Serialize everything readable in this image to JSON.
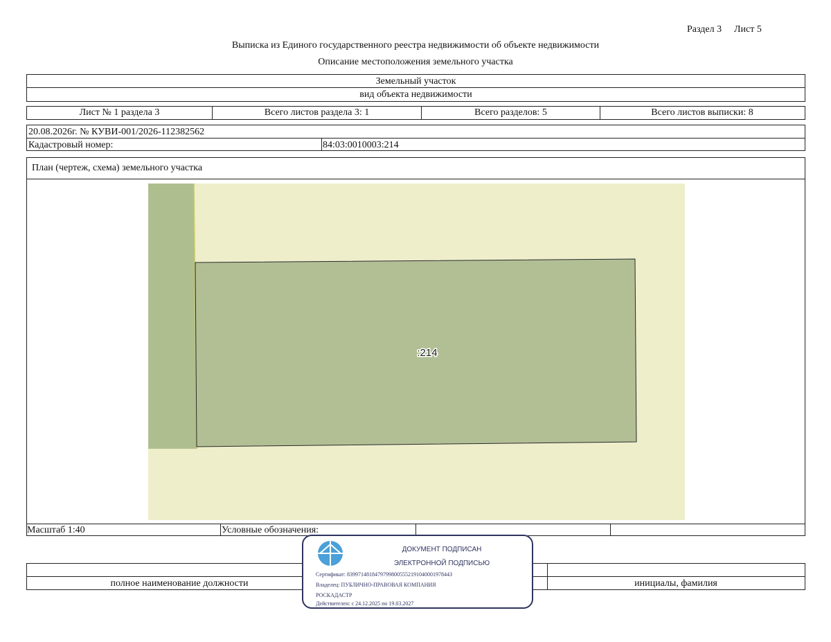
{
  "header": {
    "section_ref": "Раздел 3",
    "sheet_ref": "Лист 5",
    "title": "Выписка из Единого государственного реестра недвижимости об объекте недвижимости",
    "subtitle": "Описание местоположения земельного участка"
  },
  "object": {
    "type_value": "Земельный участок",
    "type_caption": "вид объекта недвижимости"
  },
  "sheets": {
    "sheet_no": "Лист № 1 раздела 3",
    "total_section_sheets": "Всего листов раздела 3: 1",
    "total_sections": "Всего разделов: 5",
    "total_extract_sheets": "Всего листов выписки: 8"
  },
  "record": {
    "date_number": "20.08.2026г. № КУВИ-001/2026-112382562",
    "cadastral_label": "Кадастровый номер:",
    "cadastral_value": "84:03:0010003:214"
  },
  "plan": {
    "title": "План (чертеж, схема) земельного участка",
    "parcel_label": ":214",
    "colors": {
      "background": "#eeeecb",
      "parcel": "#b2bf95",
      "neighbor": "#afbe8e",
      "outline": "#2a2a2a"
    }
  },
  "footer": {
    "scale": "Масштаб 1:40",
    "legend_label": "Условные обозначения:",
    "position_caption": "полное наименование должности",
    "name_caption": "инициалы, фамилия"
  },
  "stamp": {
    "line1": "ДОКУМЕНТ ПОДПИСАН",
    "line2": "ЭЛЕКТРОННОЙ ПОДПИСЬЮ",
    "certificate": "Сертификат: 8399714818479799800555219104000197844З",
    "owner_line1": "Владелец: ПУБЛИЧНО-ПРАВОВАЯ КОМПАНИЯ",
    "owner_line2": "РОСКАДАСТР",
    "valid": "Действителен: с 24.12.2025 по 19.03.2027",
    "logo_icon": "roskadastr-logo-icon",
    "color": "#2e3360"
  }
}
